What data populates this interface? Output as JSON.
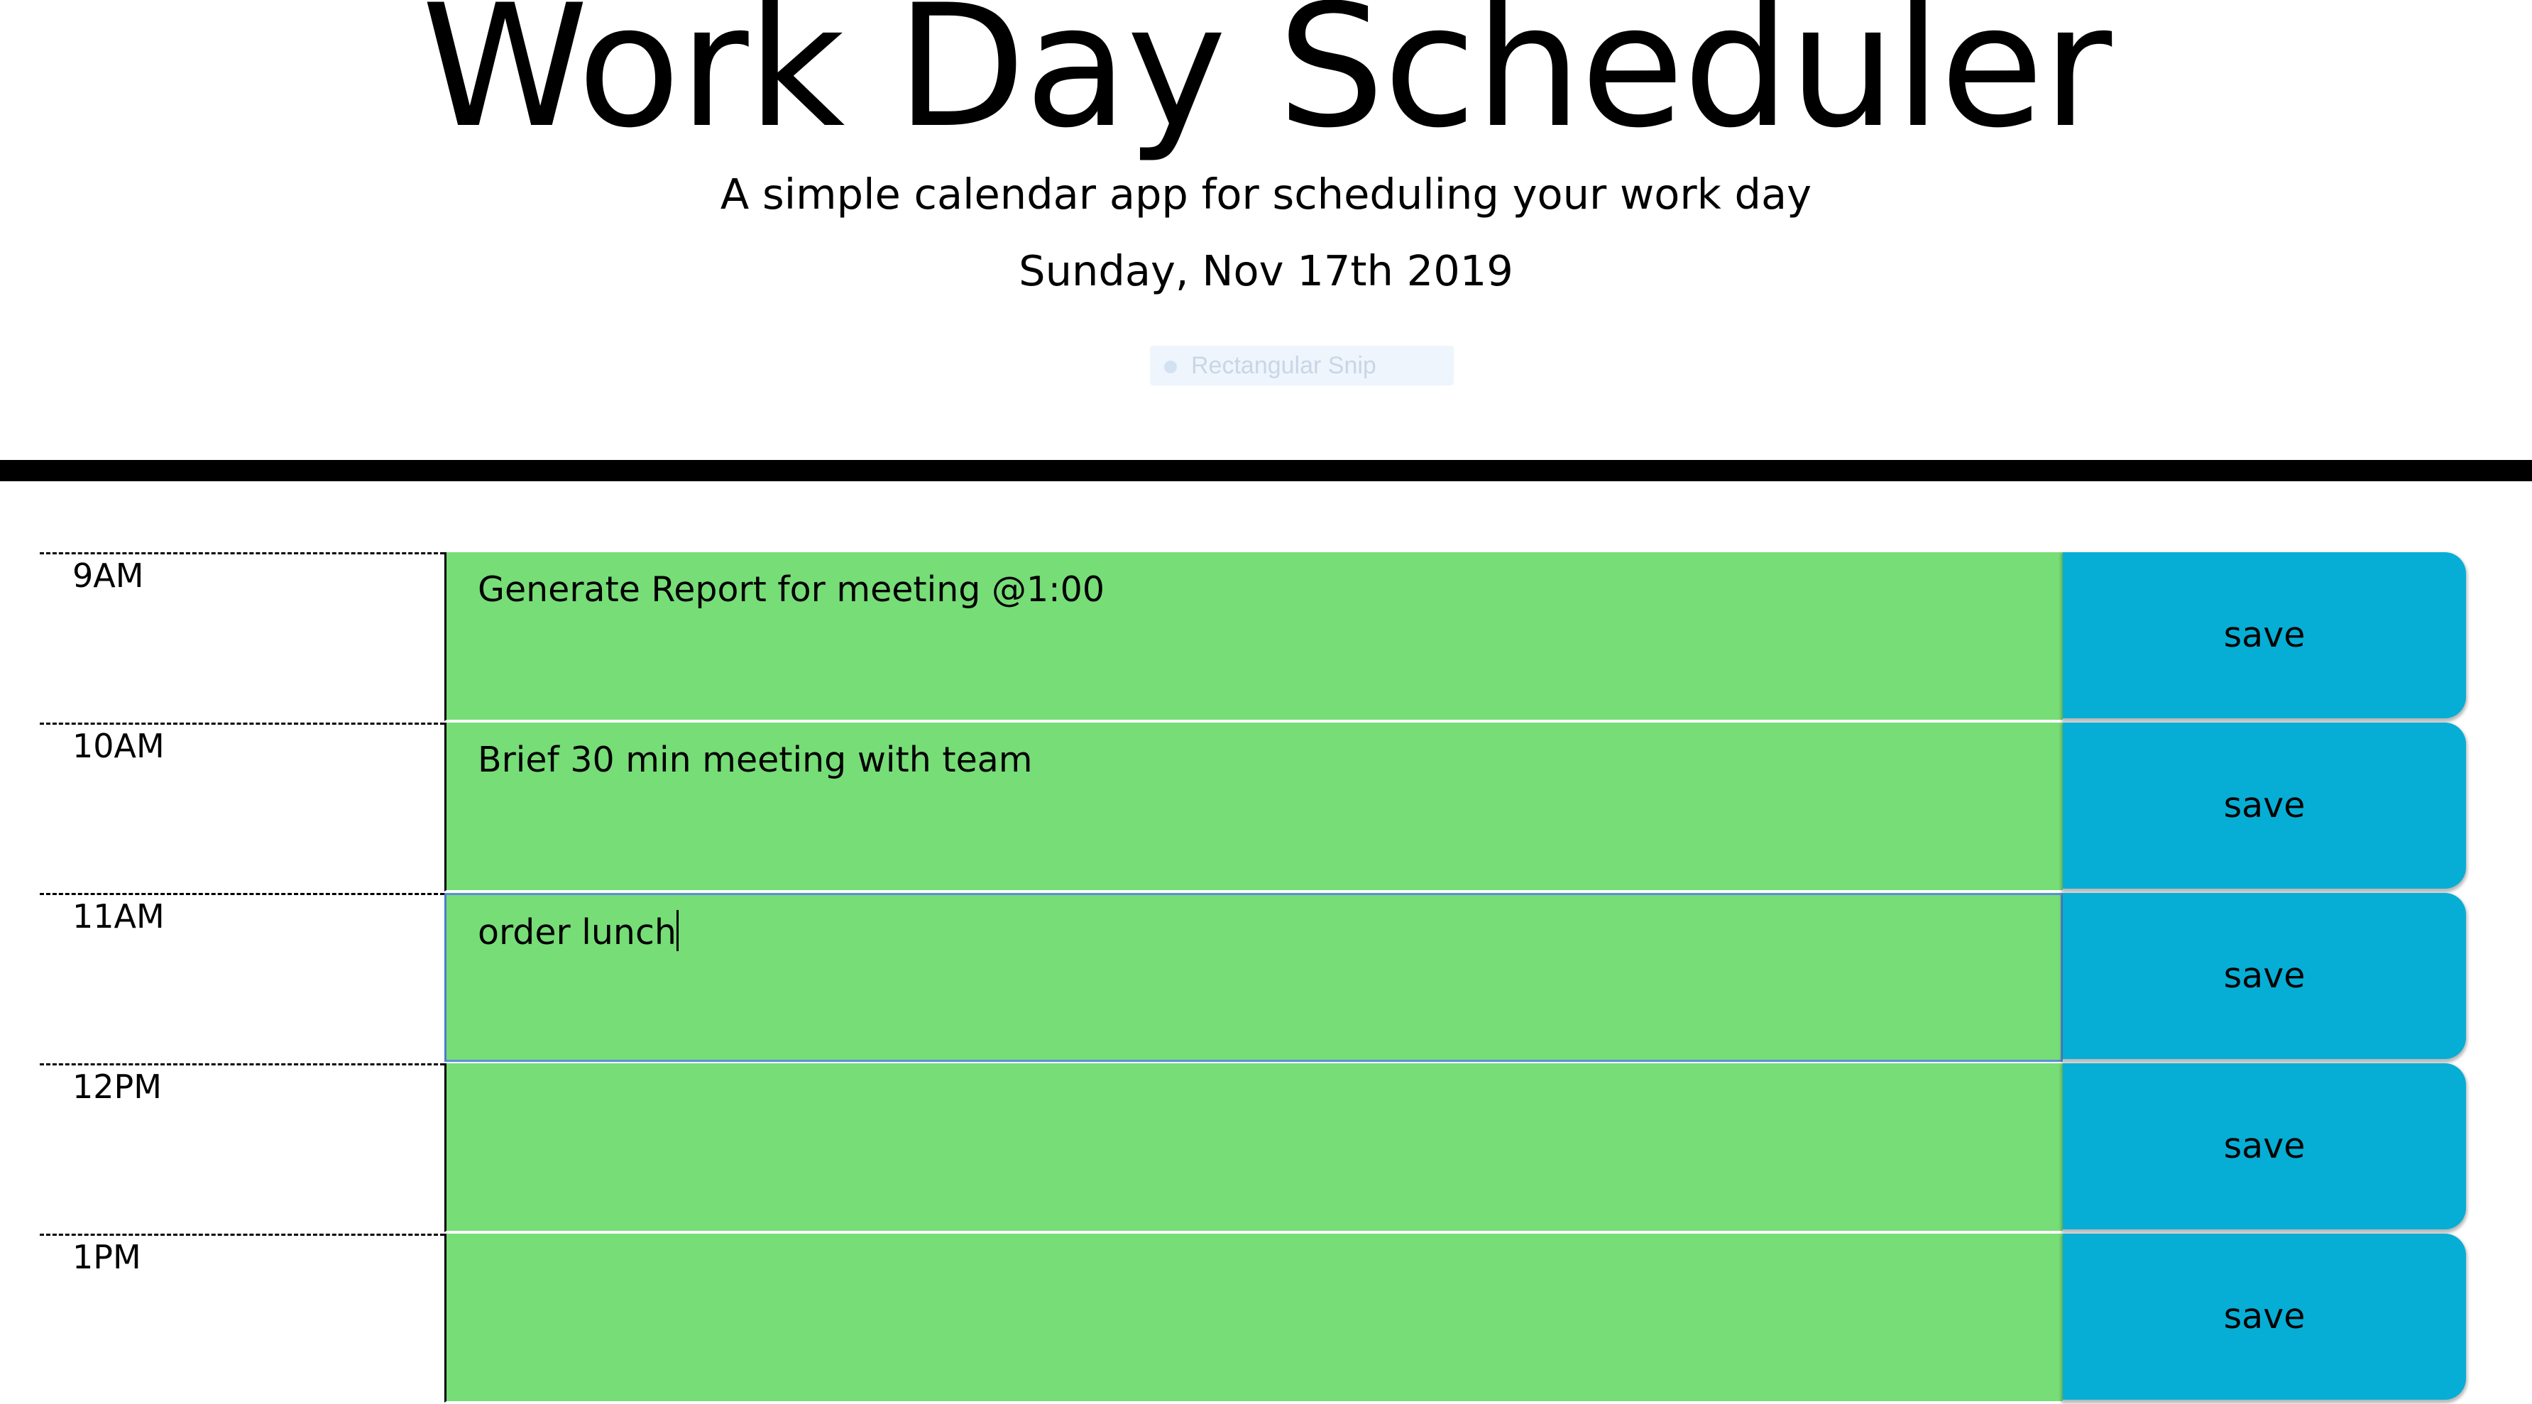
{
  "header": {
    "title": "Work Day Scheduler",
    "subtitle": "A simple calendar app for scheduling your work day",
    "current_day": "Sunday, Nov 17th 2019"
  },
  "snip_overlay": {
    "label": "Rectangular Snip",
    "icon": "snip-icon"
  },
  "colors": {
    "present_block": "#77dd77",
    "save_button": "#06aed5",
    "divider": "#000000"
  },
  "timeblocks": [
    {
      "hour": "9AM",
      "text": "Generate Report for meeting @1:00",
      "save_label": "save"
    },
    {
      "hour": "10AM",
      "text": "Brief 30 min meeting with team",
      "save_label": "save"
    },
    {
      "hour": "11AM",
      "text": "order lunch",
      "save_label": "save"
    },
    {
      "hour": "12PM",
      "text": "",
      "save_label": "save"
    },
    {
      "hour": "1PM",
      "text": "",
      "save_label": "save"
    }
  ]
}
